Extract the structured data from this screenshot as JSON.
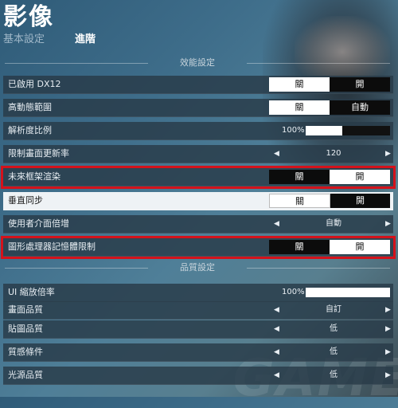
{
  "header": {
    "title": "影像",
    "tabs": [
      "基本設定",
      "進階"
    ]
  },
  "watermark": "GAME",
  "sections": {
    "perf": "效能設定",
    "quality": "品質設定"
  },
  "rows": {
    "dx12": {
      "label": "已啟用 DX12",
      "opts": [
        "關",
        "開"
      ],
      "selected": "關"
    },
    "hdr": {
      "label": "高動態範圍",
      "opts": [
        "關",
        "自動"
      ],
      "selected": "關"
    },
    "resolution": {
      "label": "解析度比例",
      "value": "100%",
      "fill": 0.43
    },
    "framerate": {
      "label": "限制畫面更新率",
      "value": "120"
    },
    "future_frame": {
      "label": "未來框架渲染",
      "opts": [
        "關",
        "開"
      ],
      "selected": "開"
    },
    "vsync": {
      "label": "垂直同步",
      "opts": [
        "關",
        "開"
      ],
      "selected": "關"
    },
    "ui_scale_mult": {
      "label": "使用者介面倍增",
      "value": "自動"
    },
    "gpu_mem": {
      "label": "圖形處理器記憶體限制",
      "opts": [
        "關",
        "開"
      ],
      "selected": "開"
    },
    "ui_zoom": {
      "label": "UI 縮放倍率",
      "value": "100%",
      "fill": 1.0
    },
    "graphics_quality": {
      "label": "畫面品質",
      "value": "自訂"
    },
    "texture_quality": {
      "label": "貼圖品質",
      "value": "低"
    },
    "material_quality": {
      "label": "質感條件",
      "value": "低"
    },
    "light_quality": {
      "label": "光源品質",
      "value": "低"
    }
  },
  "colors": {
    "highlight": "#d4121b",
    "row_bg": "#283a48",
    "on": "#ffffff",
    "off": "#0c0c0c"
  },
  "icons": {
    "left": "arrow-left-icon",
    "right": "arrow-right-icon"
  }
}
